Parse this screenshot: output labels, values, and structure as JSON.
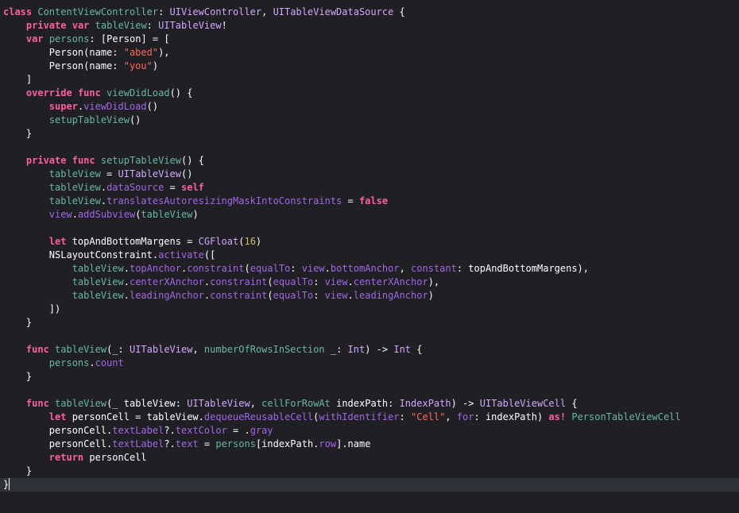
{
  "code_editor": {
    "language": "swift",
    "current_line": 36,
    "lines": [
      [
        {
          "t": "class",
          "k": "kw"
        },
        {
          "t": " "
        },
        {
          "t": "ContentViewController",
          "k": "fn"
        },
        {
          "t": ": "
        },
        {
          "t": "UIViewController",
          "k": "typ"
        },
        {
          "t": ", "
        },
        {
          "t": "UITableViewDataSource",
          "k": "typ"
        },
        {
          "t": " {"
        }
      ],
      [
        {
          "t": "    "
        },
        {
          "t": "private",
          "k": "kw"
        },
        {
          "t": " "
        },
        {
          "t": "var",
          "k": "kw"
        },
        {
          "t": " "
        },
        {
          "t": "tableView",
          "k": "fn"
        },
        {
          "t": ": "
        },
        {
          "t": "UITableView",
          "k": "typ"
        },
        {
          "t": "!"
        }
      ],
      [
        {
          "t": "    "
        },
        {
          "t": "var",
          "k": "kw"
        },
        {
          "t": " "
        },
        {
          "t": "persons",
          "k": "fn"
        },
        {
          "t": ": ["
        },
        {
          "t": "Person",
          "k": "plain"
        },
        {
          "t": "] = ["
        }
      ],
      [
        {
          "t": "        Person(name: "
        },
        {
          "t": "\"abed\"",
          "k": "str"
        },
        {
          "t": "),"
        }
      ],
      [
        {
          "t": "        Person(name: "
        },
        {
          "t": "\"you\"",
          "k": "str"
        },
        {
          "t": ")"
        }
      ],
      [
        {
          "t": "    ]"
        }
      ],
      [
        {
          "t": "    "
        },
        {
          "t": "override",
          "k": "kw"
        },
        {
          "t": " "
        },
        {
          "t": "func",
          "k": "kw"
        },
        {
          "t": " "
        },
        {
          "t": "viewDidLoad",
          "k": "fn"
        },
        {
          "t": "() {"
        }
      ],
      [
        {
          "t": "        "
        },
        {
          "t": "super",
          "k": "kw"
        },
        {
          "t": "."
        },
        {
          "t": "viewDidLoad",
          "k": "prop"
        },
        {
          "t": "()"
        }
      ],
      [
        {
          "t": "        "
        },
        {
          "t": "setupTableView",
          "k": "fn"
        },
        {
          "t": "()"
        }
      ],
      [
        {
          "t": "    }"
        }
      ],
      [
        {
          "t": ""
        }
      ],
      [
        {
          "t": "    "
        },
        {
          "t": "private",
          "k": "kw"
        },
        {
          "t": " "
        },
        {
          "t": "func",
          "k": "kw"
        },
        {
          "t": " "
        },
        {
          "t": "setupTableView",
          "k": "fn"
        },
        {
          "t": "() {"
        }
      ],
      [
        {
          "t": "        "
        },
        {
          "t": "tableView",
          "k": "fn"
        },
        {
          "t": " = "
        },
        {
          "t": "UITableView",
          "k": "typ"
        },
        {
          "t": "()"
        }
      ],
      [
        {
          "t": "        "
        },
        {
          "t": "tableView",
          "k": "fn"
        },
        {
          "t": "."
        },
        {
          "t": "dataSource",
          "k": "prop"
        },
        {
          "t": " = "
        },
        {
          "t": "self",
          "k": "kw"
        }
      ],
      [
        {
          "t": "        "
        },
        {
          "t": "tableView",
          "k": "fn"
        },
        {
          "t": "."
        },
        {
          "t": "translatesAutoresizingMaskIntoConstraints",
          "k": "prop"
        },
        {
          "t": " = "
        },
        {
          "t": "false",
          "k": "kw"
        }
      ],
      [
        {
          "t": "        "
        },
        {
          "t": "view",
          "k": "prop"
        },
        {
          "t": "."
        },
        {
          "t": "addSubview",
          "k": "prop"
        },
        {
          "t": "("
        },
        {
          "t": "tableView",
          "k": "fn"
        },
        {
          "t": ")"
        }
      ],
      [
        {
          "t": ""
        }
      ],
      [
        {
          "t": "        "
        },
        {
          "t": "let",
          "k": "kw"
        },
        {
          "t": " topAndBottomMargens = "
        },
        {
          "t": "CGFloat",
          "k": "typ"
        },
        {
          "t": "("
        },
        {
          "t": "16",
          "k": "num"
        },
        {
          "t": ")"
        }
      ],
      [
        {
          "t": "        "
        },
        {
          "t": "NSLayoutConstraint",
          "k": "plain"
        },
        {
          "t": "."
        },
        {
          "t": "activate",
          "k": "prop"
        },
        {
          "t": "(["
        }
      ],
      [
        {
          "t": "            "
        },
        {
          "t": "tableView",
          "k": "fn"
        },
        {
          "t": "."
        },
        {
          "t": "topAnchor",
          "k": "prop"
        },
        {
          "t": "."
        },
        {
          "t": "constraint",
          "k": "prop"
        },
        {
          "t": "("
        },
        {
          "t": "equalTo",
          "k": "prop"
        },
        {
          "t": ": "
        },
        {
          "t": "view",
          "k": "prop"
        },
        {
          "t": "."
        },
        {
          "t": "bottomAnchor",
          "k": "prop"
        },
        {
          "t": ", "
        },
        {
          "t": "constant",
          "k": "prop"
        },
        {
          "t": ": topAndBottomMargens),"
        }
      ],
      [
        {
          "t": "            "
        },
        {
          "t": "tableView",
          "k": "fn"
        },
        {
          "t": "."
        },
        {
          "t": "centerXAnchor",
          "k": "prop"
        },
        {
          "t": "."
        },
        {
          "t": "constraint",
          "k": "prop"
        },
        {
          "t": "("
        },
        {
          "t": "equalTo",
          "k": "prop"
        },
        {
          "t": ": "
        },
        {
          "t": "view",
          "k": "prop"
        },
        {
          "t": "."
        },
        {
          "t": "centerXAnchor",
          "k": "prop"
        },
        {
          "t": "),"
        }
      ],
      [
        {
          "t": "            "
        },
        {
          "t": "tableView",
          "k": "fn"
        },
        {
          "t": "."
        },
        {
          "t": "leadingAnchor",
          "k": "prop"
        },
        {
          "t": "."
        },
        {
          "t": "constraint",
          "k": "prop"
        },
        {
          "t": "("
        },
        {
          "t": "equalTo",
          "k": "prop"
        },
        {
          "t": ": "
        },
        {
          "t": "view",
          "k": "prop"
        },
        {
          "t": "."
        },
        {
          "t": "leadingAnchor",
          "k": "prop"
        },
        {
          "t": ")"
        }
      ],
      [
        {
          "t": "        ])"
        }
      ],
      [
        {
          "t": "    }"
        }
      ],
      [
        {
          "t": ""
        }
      ],
      [
        {
          "t": "    "
        },
        {
          "t": "func",
          "k": "kw"
        },
        {
          "t": " "
        },
        {
          "t": "tableView",
          "k": "fn"
        },
        {
          "t": "(_: "
        },
        {
          "t": "UITableView",
          "k": "typ"
        },
        {
          "t": ", "
        },
        {
          "t": "numberOfRowsInSection",
          "k": "fn"
        },
        {
          "t": " _: "
        },
        {
          "t": "Int",
          "k": "typ"
        },
        {
          "t": ") -> "
        },
        {
          "t": "Int",
          "k": "typ"
        },
        {
          "t": " {"
        }
      ],
      [
        {
          "t": "        "
        },
        {
          "t": "persons",
          "k": "fn"
        },
        {
          "t": "."
        },
        {
          "t": "count",
          "k": "prop"
        }
      ],
      [
        {
          "t": "    }"
        }
      ],
      [
        {
          "t": ""
        }
      ],
      [
        {
          "t": "    "
        },
        {
          "t": "func",
          "k": "kw"
        },
        {
          "t": " "
        },
        {
          "t": "tableView",
          "k": "fn"
        },
        {
          "t": "(_ tableView: "
        },
        {
          "t": "UITableView",
          "k": "typ"
        },
        {
          "t": ", "
        },
        {
          "t": "cellForRowAt",
          "k": "fn"
        },
        {
          "t": " indexPath: "
        },
        {
          "t": "IndexPath",
          "k": "typ"
        },
        {
          "t": ") -> "
        },
        {
          "t": "UITableViewCell",
          "k": "typ"
        },
        {
          "t": " {"
        }
      ],
      [
        {
          "t": "        "
        },
        {
          "t": "let",
          "k": "kw"
        },
        {
          "t": " personCell = tableView."
        },
        {
          "t": "dequeueReusableCell",
          "k": "prop"
        },
        {
          "t": "("
        },
        {
          "t": "withIdentifier",
          "k": "prop"
        },
        {
          "t": ": "
        },
        {
          "t": "\"Cell\"",
          "k": "str"
        },
        {
          "t": ", "
        },
        {
          "t": "for",
          "k": "prop"
        },
        {
          "t": ": indexPath) "
        },
        {
          "t": "as!",
          "k": "kw"
        },
        {
          "t": " "
        },
        {
          "t": "PersonTableViewCell",
          "k": "fn"
        }
      ],
      [
        {
          "t": "        personCell."
        },
        {
          "t": "textLabel",
          "k": "prop"
        },
        {
          "t": "?."
        },
        {
          "t": "textColor",
          "k": "prop"
        },
        {
          "t": " = ."
        },
        {
          "t": "gray",
          "k": "prop"
        }
      ],
      [
        {
          "t": "        personCell."
        },
        {
          "t": "textLabel",
          "k": "prop"
        },
        {
          "t": "?."
        },
        {
          "t": "text",
          "k": "prop"
        },
        {
          "t": " = "
        },
        {
          "t": "persons",
          "k": "fn"
        },
        {
          "t": "[indexPath."
        },
        {
          "t": "row",
          "k": "prop"
        },
        {
          "t": "].name"
        }
      ],
      [
        {
          "t": "        "
        },
        {
          "t": "return",
          "k": "kw"
        },
        {
          "t": " personCell"
        }
      ],
      [
        {
          "t": "    }"
        }
      ],
      [
        {
          "t": "}"
        }
      ]
    ]
  }
}
